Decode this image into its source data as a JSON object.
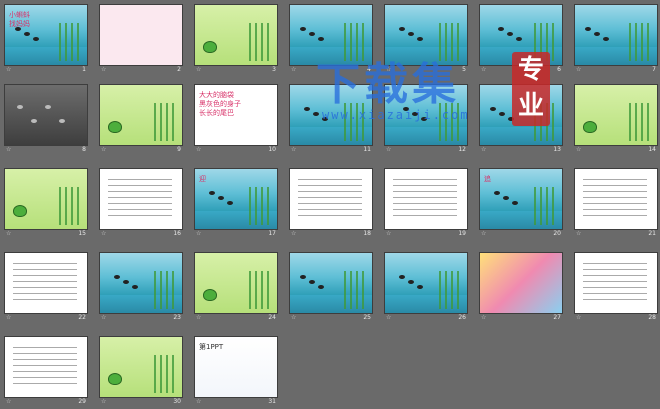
{
  "slides": [
    {
      "number": "1",
      "style": "pond",
      "title": "小蝌蚪\n找妈妈",
      "title_color": "red"
    },
    {
      "number": "2",
      "style": "pink",
      "title": "",
      "title_color": "dark"
    },
    {
      "number": "3",
      "style": "green",
      "title": "",
      "title_color": "dark"
    },
    {
      "number": "4",
      "style": "pond",
      "title": "",
      "title_color": "dark"
    },
    {
      "number": "5",
      "style": "pond",
      "title": "",
      "title_color": "dark"
    },
    {
      "number": "6",
      "style": "pond",
      "title": "",
      "title_color": "dark"
    },
    {
      "number": "7",
      "style": "pond",
      "title": "",
      "title_color": "dark"
    },
    {
      "number": "8",
      "style": "dark",
      "title": "",
      "title_color": "dark"
    },
    {
      "number": "9",
      "style": "green",
      "title": "",
      "title_color": "dark"
    },
    {
      "number": "10",
      "style": "white",
      "title": "大大的脑袋\n黑灰色的身子\n长长的尾巴",
      "title_color": "red"
    },
    {
      "number": "11",
      "style": "pond",
      "title": "",
      "title_color": "dark"
    },
    {
      "number": "12",
      "style": "pond",
      "title": "",
      "title_color": "dark"
    },
    {
      "number": "13",
      "style": "pond",
      "title": "",
      "title_color": "dark"
    },
    {
      "number": "14",
      "style": "green",
      "title": "",
      "title_color": "green"
    },
    {
      "number": "15",
      "style": "green",
      "title": "",
      "title_color": "dark"
    },
    {
      "number": "16",
      "style": "white",
      "title": "",
      "title_color": "dark"
    },
    {
      "number": "17",
      "style": "pond",
      "title": "迎",
      "title_color": "red"
    },
    {
      "number": "18",
      "style": "white",
      "title": "",
      "title_color": "dark"
    },
    {
      "number": "19",
      "style": "white",
      "title": "",
      "title_color": "dark"
    },
    {
      "number": "20",
      "style": "pond",
      "title": "追",
      "title_color": "red"
    },
    {
      "number": "21",
      "style": "white",
      "title": "",
      "title_color": "dark"
    },
    {
      "number": "22",
      "style": "white",
      "title": "",
      "title_color": "dark"
    },
    {
      "number": "23",
      "style": "pond",
      "title": "",
      "title_color": "dark"
    },
    {
      "number": "24",
      "style": "green",
      "title": "",
      "title_color": "dark"
    },
    {
      "number": "25",
      "style": "pond",
      "title": "",
      "title_color": "dark"
    },
    {
      "number": "26",
      "style": "pond",
      "title": "",
      "title_color": "dark"
    },
    {
      "number": "27",
      "style": "bright",
      "title": "",
      "title_color": "dark"
    },
    {
      "number": "28",
      "style": "white",
      "title": "",
      "title_color": "green"
    },
    {
      "number": "29",
      "style": "white",
      "title": "",
      "title_color": "dark"
    },
    {
      "number": "30",
      "style": "green",
      "title": "",
      "title_color": "dark"
    },
    {
      "number": "31",
      "style": "card",
      "title": "第1PPT",
      "title_color": "dark"
    }
  ],
  "watermark": {
    "text": "下载集",
    "badge": "专\n业",
    "url": "www.xiazaiji.com"
  },
  "colors": {
    "background": "#6a6a6a",
    "watermark_blue": "#286edc",
    "badge_red": "#c82828"
  }
}
